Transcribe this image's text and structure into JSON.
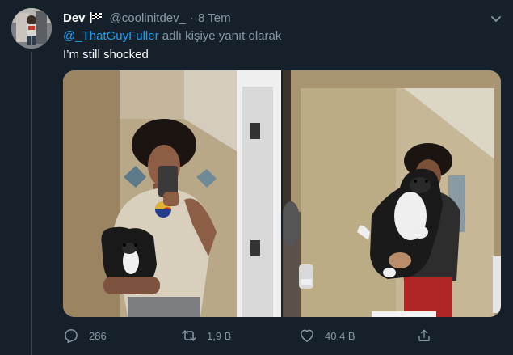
{
  "tweet": {
    "display_name": "Dev",
    "handle": "@coolinitdev_",
    "separator": "·",
    "date": "8 Tem",
    "reply_mention": "@_ThatGuyFuller",
    "reply_suffix": " adlı kişiye yanıt olarak",
    "text": "I’m still shocked"
  },
  "actions": {
    "reply_count": "286",
    "retweet_count": "1,9 B",
    "like_count": "40,4 B"
  },
  "icons": {
    "name_badge": "checkered-flag-icon",
    "more": "chevron-down-icon",
    "reply": "reply-icon",
    "retweet": "retweet-icon",
    "like": "heart-icon",
    "share": "share-icon"
  },
  "colors": {
    "background": "#15202b",
    "muted_text": "#8899a6",
    "link": "#1da1f2",
    "thread_line": "#38444d"
  }
}
